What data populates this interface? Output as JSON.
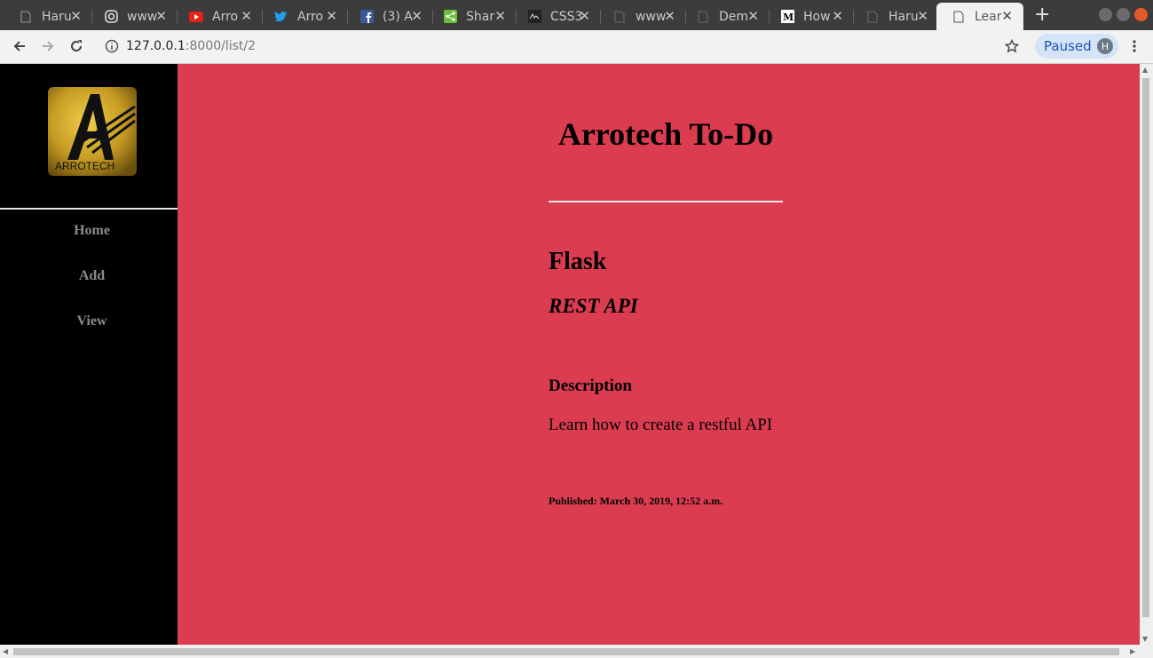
{
  "tabs": [
    {
      "title": "Haru",
      "icon": "page-icon"
    },
    {
      "title": "www",
      "icon": "instagram-icon"
    },
    {
      "title": "Arro",
      "icon": "youtube-icon"
    },
    {
      "title": "Arro",
      "icon": "twitter-icon"
    },
    {
      "title": "(3) A",
      "icon": "facebook-icon"
    },
    {
      "title": "Shar",
      "icon": "share-icon"
    },
    {
      "title": "CSS3",
      "icon": "css-site-icon"
    },
    {
      "title": "www",
      "icon": "page-icon"
    },
    {
      "title": "Dem",
      "icon": "page-icon"
    },
    {
      "title": "How",
      "icon": "medium-icon"
    },
    {
      "title": "Haru",
      "icon": "page-icon"
    },
    {
      "title": "Lear",
      "icon": "page-icon",
      "active": true
    }
  ],
  "toolbar": {
    "url_host": "127.0.0.1",
    "url_rest": ":8000/list/2",
    "profile_status": "Paused",
    "profile_initial": "H"
  },
  "sidebar": {
    "logo_text": "ARROTECH",
    "links": [
      "Home",
      "Add",
      "View"
    ]
  },
  "main": {
    "title": "Arrotech To-Do",
    "item_name": "Flask",
    "item_subtitle": "REST API",
    "description_heading": "Description",
    "description_text": "Learn how to create a restful API",
    "published": "Published: March 30, 2019, 12:52 a.m."
  },
  "colors": {
    "main_bg": "#db3c50",
    "sidebar_bg": "#000000",
    "nav_link": "#8a8a8a",
    "tabstrip_bg": "#3c3c3c"
  }
}
